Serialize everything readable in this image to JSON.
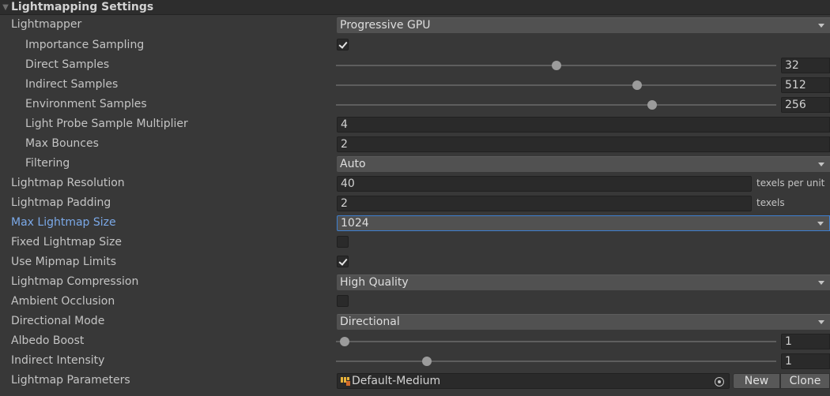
{
  "section": {
    "title": "Lightmapping Settings"
  },
  "lightmapper": {
    "label": "Lightmapper",
    "value": "Progressive GPU"
  },
  "importance_sampling": {
    "label": "Importance Sampling",
    "checked": true
  },
  "direct_samples": {
    "label": "Direct Samples",
    "value": "32",
    "slider_fraction": 0.5
  },
  "indirect_samples": {
    "label": "Indirect Samples",
    "value": "512",
    "slider_fraction": 0.688
  },
  "environment_samples": {
    "label": "Environment Samples",
    "value": "256",
    "slider_fraction": 0.723
  },
  "light_probe_sample_multiplier": {
    "label": "Light Probe Sample Multiplier",
    "value": "4"
  },
  "max_bounces": {
    "label": "Max Bounces",
    "value": "2"
  },
  "filtering": {
    "label": "Filtering",
    "value": "Auto"
  },
  "lightmap_resolution": {
    "label": "Lightmap Resolution",
    "value": "40",
    "suffix": "texels per unit"
  },
  "lightmap_padding": {
    "label": "Lightmap Padding",
    "value": "2",
    "suffix": "texels"
  },
  "max_lightmap_size": {
    "label": "Max Lightmap Size",
    "value": "1024"
  },
  "fixed_lightmap_size": {
    "label": "Fixed Lightmap Size",
    "checked": false
  },
  "use_mipmap_limits": {
    "label": "Use Mipmap Limits",
    "checked": true
  },
  "lightmap_compression": {
    "label": "Lightmap Compression",
    "value": "High Quality"
  },
  "ambient_occlusion": {
    "label": "Ambient Occlusion",
    "checked": false
  },
  "directional_mode": {
    "label": "Directional Mode",
    "value": "Directional"
  },
  "albedo_boost": {
    "label": "Albedo Boost",
    "value": "1",
    "slider_fraction": 0.01
  },
  "indirect_intensity": {
    "label": "Indirect Intensity",
    "value": "1",
    "slider_fraction": 0.2
  },
  "lightmap_parameters": {
    "label": "Lightmap Parameters",
    "value": "Default-Medium",
    "new_label": "New",
    "clone_label": "Clone"
  },
  "icons": {
    "fold": "triangle-down-icon",
    "dropdown": "chevron-down-icon",
    "check": "checkmark-icon",
    "asset": "lightmap-parameters-asset-icon",
    "picker": "object-picker-icon"
  },
  "colors": {
    "background": "#383838",
    "highlight_label": "#7ba9e8",
    "focus_border": "#3d7fd0"
  }
}
